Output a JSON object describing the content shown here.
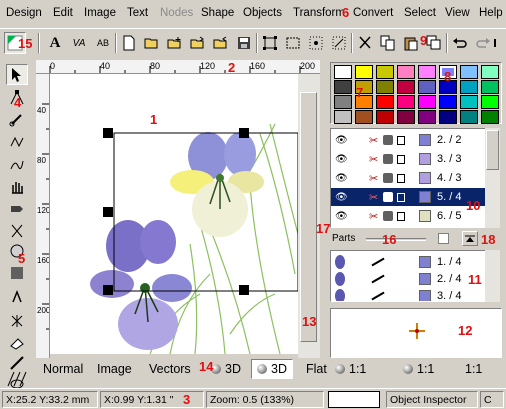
{
  "menu": {
    "items": [
      "Design",
      "Edit",
      "Image",
      "Text",
      "Nodes",
      "Shape",
      "Objects",
      "Transform",
      "Convert",
      "Select",
      "View",
      "Help"
    ],
    "disabled_index": 4
  },
  "toolbar": {
    "text_a": "A",
    "text_va": "VA",
    "text_ab": "AB"
  },
  "rulers": {
    "top_ticks": [
      "0",
      "40",
      "80",
      "120",
      "160",
      "200"
    ],
    "left_ticks": [
      "40",
      "80",
      "120",
      "160",
      "200"
    ]
  },
  "palette": {
    "colors": [
      "#ffffff",
      "#ffff00",
      "#c8c800",
      "#ff80c0",
      "#ff80ff",
      "#8080ff",
      "#80c0ff",
      "#80ffc0",
      "#404040",
      "#c0a000",
      "#808000",
      "#c00040",
      "#6060c0",
      "#0000c0",
      "#00a0c0",
      "#00c060",
      "#808080",
      "#ff8000",
      "#ff0000",
      "#ff0080",
      "#ff00ff",
      "#0000ff",
      "#00c0c0",
      "#00ff00",
      "#c0c0c0",
      "#a05020",
      "#c00000",
      "#800040",
      "#800080",
      "#000080",
      "#008080",
      "#008000"
    ],
    "selected_index": 5
  },
  "layers": {
    "rows": [
      {
        "label": "2. / 2",
        "color": "#8080d0"
      },
      {
        "label": "3. / 3",
        "color": "#b0a0e0"
      },
      {
        "label": "4. / 3",
        "color": "#b0a0e0"
      },
      {
        "label": "5. / 4",
        "color": "#8080d0"
      },
      {
        "label": "6. / 5",
        "color": "#e0e0c0"
      }
    ],
    "selected_index": 3
  },
  "parts": {
    "label": "Parts",
    "rows": [
      {
        "label": "1. / 4",
        "color": "#8080d0"
      },
      {
        "label": "2. / 4",
        "color": "#8080d0"
      },
      {
        "label": "3. / 4",
        "color": "#8080d0"
      }
    ]
  },
  "view_tabs": [
    "Normal",
    "Image",
    "Vectors",
    "3D",
    "3D",
    "Flat"
  ],
  "view_tabs_active": 4,
  "render_tabs": [
    "1:1",
    "1:1",
    "1:1"
  ],
  "status": {
    "position": "X:25.2 Y:33.2 mm",
    "delta": "X:0.99 Y:1.31 \"",
    "zoom": "Zoom: 0.5 (133%)",
    "color_box": "",
    "inspector": "Object Inspector",
    "tail": "C"
  },
  "callouts": [
    "1",
    "2",
    "3",
    "4",
    "5",
    "6",
    "7",
    "8",
    "9",
    "10",
    "11",
    "12",
    "13",
    "14",
    "15",
    "16",
    "17",
    "18"
  ]
}
